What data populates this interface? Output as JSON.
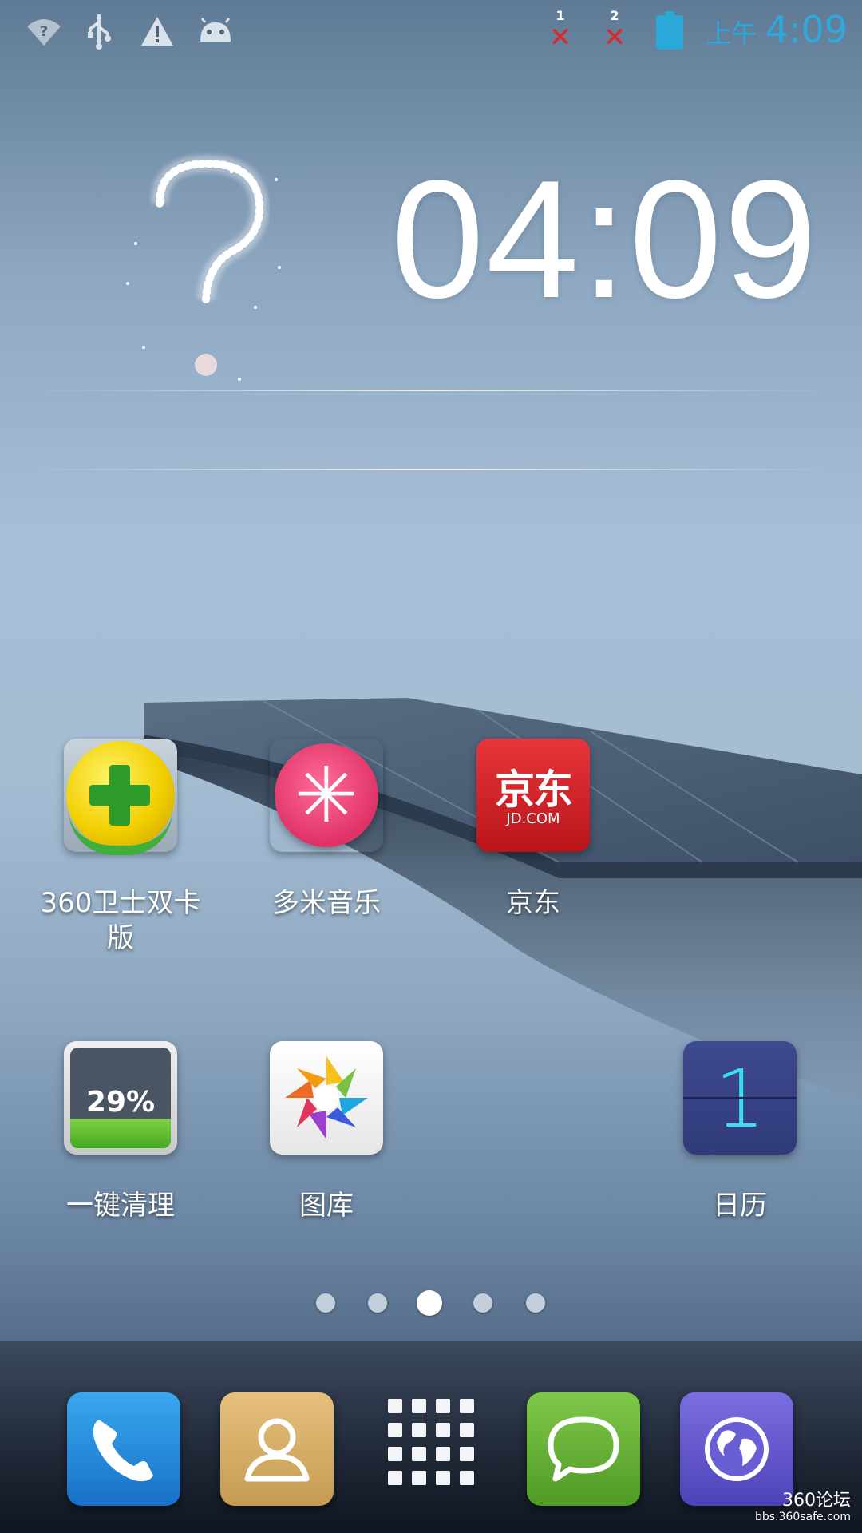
{
  "status_bar": {
    "icons": [
      "wifi-unknown-icon",
      "usb-icon",
      "warning-icon",
      "android-icon"
    ],
    "sim1": {
      "number": "1",
      "status": "✕"
    },
    "sim2": {
      "number": "2",
      "status": "✕"
    },
    "ampm": "上午",
    "time": "4:09"
  },
  "clock_widget": {
    "time": "04:09",
    "weather_icon": "question-mark-sparkle"
  },
  "apps": [
    {
      "label": "360卫士双卡版",
      "icon": "360-security-icon"
    },
    {
      "label": "多米音乐",
      "icon": "music-icon"
    },
    {
      "label": "京东",
      "icon": "jd-icon",
      "icon_text": "京东",
      "icon_subtext": "JD.COM"
    },
    {
      "label": "一键清理",
      "icon": "cleaner-icon",
      "icon_text": "29%",
      "level": 0.29
    },
    {
      "label": "图库",
      "icon": "gallery-icon"
    },
    {
      "label": "日历",
      "icon": "calendar-icon",
      "icon_text": "1"
    }
  ],
  "page_indicator": {
    "count": 5,
    "active": 3
  },
  "dock": [
    {
      "name": "phone",
      "icon": "phone-icon"
    },
    {
      "name": "contacts",
      "icon": "contacts-icon"
    },
    {
      "name": "all-apps",
      "icon": "app-grid-icon"
    },
    {
      "name": "messages",
      "icon": "message-icon"
    },
    {
      "name": "browser",
      "icon": "globe-icon"
    }
  ],
  "watermark": {
    "title": "360论坛",
    "url": "bbs.360safe.com"
  },
  "colors": {
    "status_accent": "#2ea9dc",
    "sim_error": "#d9282e",
    "jd_red": "#e8363a",
    "clean_green": "#45a821"
  }
}
